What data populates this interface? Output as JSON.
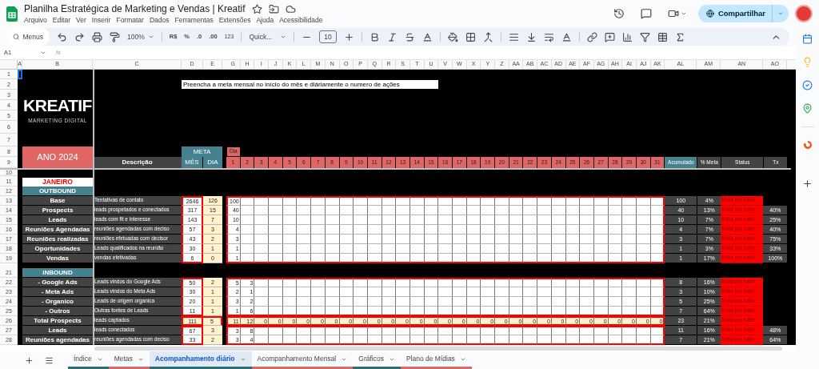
{
  "document": {
    "title": "Planilha Estratégica de Marketing e Vendas | Kreatif",
    "menu": [
      "Arquivo",
      "Editar",
      "Ver",
      "Inserir",
      "Formatar",
      "Dados",
      "Ferramentas",
      "Extensões",
      "Ajuda",
      "Acessibilidade"
    ],
    "share_button": "Compartilhar"
  },
  "toolbar": {
    "search_placeholder": "Menus",
    "zoom": "100%",
    "currency": "R$",
    "percent": "%",
    "decimal_decrease": ".0",
    "decimal_increase": ".00",
    "number_format": "123",
    "font": "Quick...",
    "font_size": "10"
  },
  "formula_bar": {
    "cell_ref": "A1",
    "fx": "fx"
  },
  "column_headers": [
    "A",
    "B",
    "C",
    "D",
    "E",
    "G",
    "H",
    "I",
    "J",
    "K",
    "L",
    "M",
    "N",
    "O",
    "P",
    "Q",
    "R",
    "S",
    "T",
    "U",
    "V",
    "W",
    "X",
    "Y",
    "Z",
    "AA",
    "AB",
    "AC",
    "AD",
    "AE",
    "AF",
    "AG",
    "AH",
    "AI",
    "AJ",
    "AK",
    "AL",
    "AM",
    "AN",
    "AO"
  ],
  "row_numbers": [
    "1",
    "2",
    "3",
    "4",
    "5",
    "6",
    "7",
    "8",
    "9",
    "10",
    "11",
    "12",
    "13",
    "14",
    "15",
    "16",
    "17",
    "18",
    "19",
    "21",
    "22",
    "23",
    "24",
    "25",
    "26",
    "27",
    "28"
  ],
  "sheet": {
    "logo": "KREATIF",
    "logo_tagline": "MARKETING DIGITAL",
    "year": "ANO 2024",
    "note": "Preencha a meta mensal no início do mês e diáriamente o numero de ações",
    "header": {
      "description": "Descrição",
      "meta": "META",
      "month": "MÊS",
      "day": "DIA",
      "day_label": "Dia",
      "days": [
        "1",
        "2",
        "3",
        "4",
        "5",
        "6",
        "7",
        "8",
        "9",
        "10",
        "11",
        "12",
        "13",
        "14",
        "15",
        "16",
        "17",
        "18",
        "19",
        "20",
        "21",
        "22",
        "23",
        "24",
        "25",
        "26",
        "27",
        "28",
        "29",
        "30",
        "31"
      ],
      "accumulated": "Acumulado",
      "pct_goal": "% Meta",
      "status": "Status",
      "tx": "Tx"
    },
    "month": "JANEIRO",
    "sections": [
      {
        "title": "OUTBOUND",
        "rows": [
          {
            "kind": "normal",
            "label": "Base",
            "description": "Tentativas de contato",
            "goal_month": "2646",
            "goal_day": "126",
            "daily": [
              "100"
            ],
            "accumulated": "100",
            "pct_goal": "4%",
            "status": "Meta por bater"
          },
          {
            "kind": "normal",
            "label": "Prospects",
            "description": "leads prospetados e conectados",
            "goal_month": "317",
            "goal_day": "15",
            "daily": [
              "40"
            ],
            "accumulated": "40",
            "pct_goal": "13%",
            "status": "Meta por bater",
            "tx": "40%"
          },
          {
            "kind": "normal",
            "label": "Leads",
            "description": "leads com fit e interesse",
            "goal_month": "143",
            "goal_day": "7",
            "daily": [
              "10"
            ],
            "accumulated": "10",
            "pct_goal": "7%",
            "status": "Meta por bater",
            "tx": "25%"
          },
          {
            "kind": "normal",
            "label": "Reuniões Agendadas",
            "description": "reuniões agendadas com deciso",
            "goal_month": "57",
            "goal_day": "3",
            "daily": [
              "4"
            ],
            "accumulated": "4",
            "pct_goal": "7%",
            "status": "Meta por bater",
            "tx": "40%"
          },
          {
            "kind": "normal",
            "label": "Reuniões realizadas",
            "description": "reuniões efetuadas com decisor",
            "goal_month": "43",
            "goal_day": "2",
            "daily": [
              "3"
            ],
            "accumulated": "3",
            "pct_goal": "7%",
            "status": "Meta por bater",
            "tx": "75%"
          },
          {
            "kind": "normal",
            "label": "Oportunidades",
            "description": "Leads qualificados na reunião",
            "goal_month": "30",
            "goal_day": "1",
            "daily": [
              "1"
            ],
            "accumulated": "1",
            "pct_goal": "3%",
            "status": "Meta por bater",
            "tx": "33%"
          },
          {
            "kind": "normal",
            "label": "Vendas",
            "description": "vendas efetivadas",
            "goal_month": "6",
            "goal_day": "0",
            "daily": [
              "1"
            ],
            "accumulated": "1",
            "pct_goal": "17%",
            "status": "Meta por bater",
            "tx": "100%"
          }
        ]
      },
      {
        "title": "INBOUND",
        "rows": [
          {
            "kind": "normal",
            "label": "- Google Ads",
            "description": "Leads vindos do Google Ads",
            "goal_month": "50",
            "goal_day": "2",
            "daily": [
              "5",
              "3"
            ],
            "accumulated": "8",
            "pct_goal": "16%",
            "status": "Meta por bater"
          },
          {
            "kind": "normal",
            "label": "- Meta Ads",
            "description": "Leads vindos do Meta Ads",
            "goal_month": "30",
            "goal_day": "1",
            "daily": [
              "2",
              "1"
            ],
            "accumulated": "3",
            "pct_goal": "10%",
            "status": "Meta por bater"
          },
          {
            "kind": "normal",
            "label": "- Organico",
            "description": "Leads de origem organica",
            "goal_month": "20",
            "goal_day": "1",
            "daily": [
              "3",
              "2"
            ],
            "accumulated": "5",
            "pct_goal": "25%",
            "status": "Meta por bater"
          },
          {
            "kind": "normal",
            "label": "- Outros",
            "description": "Outras fontes de Leads",
            "goal_month": "11",
            "goal_day": "1",
            "daily": [
              "1",
              "6"
            ],
            "accumulated": "7",
            "pct_goal": "64%",
            "status": "Meta por bater"
          },
          {
            "kind": "total",
            "label": "Total Prospects",
            "description": "leads captados",
            "goal_month": "111",
            "goal_day": "5",
            "daily": [
              "11",
              "12",
              "0",
              "0",
              "0",
              "0",
              "0",
              "0",
              "0",
              "0",
              "0",
              "0",
              "0",
              "0",
              "0",
              "0",
              "0",
              "0",
              "0",
              "0",
              "0",
              "0",
              "0",
              "0",
              "0",
              "0",
              "0",
              "0",
              "0",
              "0",
              "0"
            ],
            "accumulated": "23",
            "pct_goal": "21%",
            "status": "Meta por bater"
          },
          {
            "kind": "normal",
            "label": "Leads",
            "description": "leads conectados",
            "goal_month": "67",
            "goal_day": "3",
            "daily": [
              "3",
              "8"
            ],
            "accumulated": "11",
            "pct_goal": "16%",
            "status": "Meta por bater",
            "tx": "48%"
          },
          {
            "kind": "normal",
            "label": "Reuniões agendadas",
            "description": "reuniões agendadas com deciso",
            "goal_month": "33",
            "goal_day": "2",
            "daily": [
              "3",
              "4"
            ],
            "accumulated": "7",
            "pct_goal": "21%",
            "status": "Meta por bater",
            "tx": "64%"
          }
        ]
      }
    ]
  },
  "sheet_tabs": [
    {
      "label": "Índice",
      "selected": false,
      "color": "#2e6e73"
    },
    {
      "label": "Metas",
      "selected": false,
      "color": "#e06666"
    },
    {
      "label": "Acompanhamento diário",
      "selected": true,
      "color": "#2e6e73"
    },
    {
      "label": "Acompanhamento Mensal",
      "selected": false,
      "color": "#e06666"
    },
    {
      "label": "Gráficos",
      "selected": false,
      "color": "#2e6e73"
    },
    {
      "label": "Plano de Mídias",
      "selected": false,
      "color": "#e06666"
    }
  ]
}
